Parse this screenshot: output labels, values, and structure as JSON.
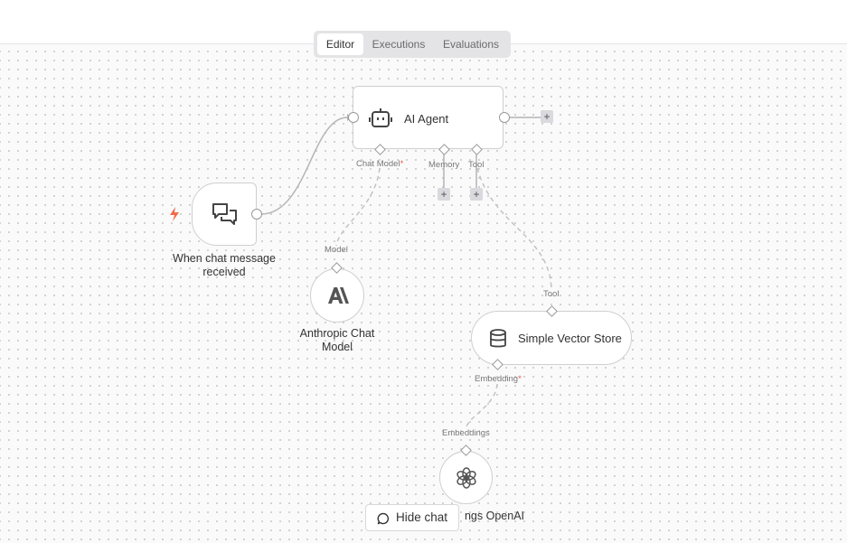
{
  "tabs": [
    {
      "label": "Editor",
      "active": true
    },
    {
      "label": "Executions",
      "active": false
    },
    {
      "label": "Evaluations",
      "active": false
    }
  ],
  "nodes": {
    "trigger": {
      "label": "When chat message received",
      "icon": "chat-bubbles-icon"
    },
    "agent": {
      "label": "AI Agent",
      "icon": "robot-icon"
    },
    "anthropic": {
      "label": "Anthropic Chat Model",
      "icon": "anthropic-icon"
    },
    "vector": {
      "label": "Simple Vector Store",
      "icon": "database-icon"
    },
    "openai": {
      "label": "ngs OpenAI",
      "icon": "openai-icon"
    }
  },
  "ports": {
    "chat_model": "Chat Model",
    "memory": "Memory",
    "tool": "Tool",
    "model": "Model",
    "tool_in": "Tool",
    "embedding": "Embedding",
    "embeddings": "Embeddings",
    "required_mark": "*"
  },
  "buttons": {
    "hide_chat": "Hide chat",
    "plus": "+"
  },
  "colors": {
    "trigger_bolt": "#f26b4a",
    "required": "#e8584a",
    "node_border": "#cfcfd4"
  }
}
